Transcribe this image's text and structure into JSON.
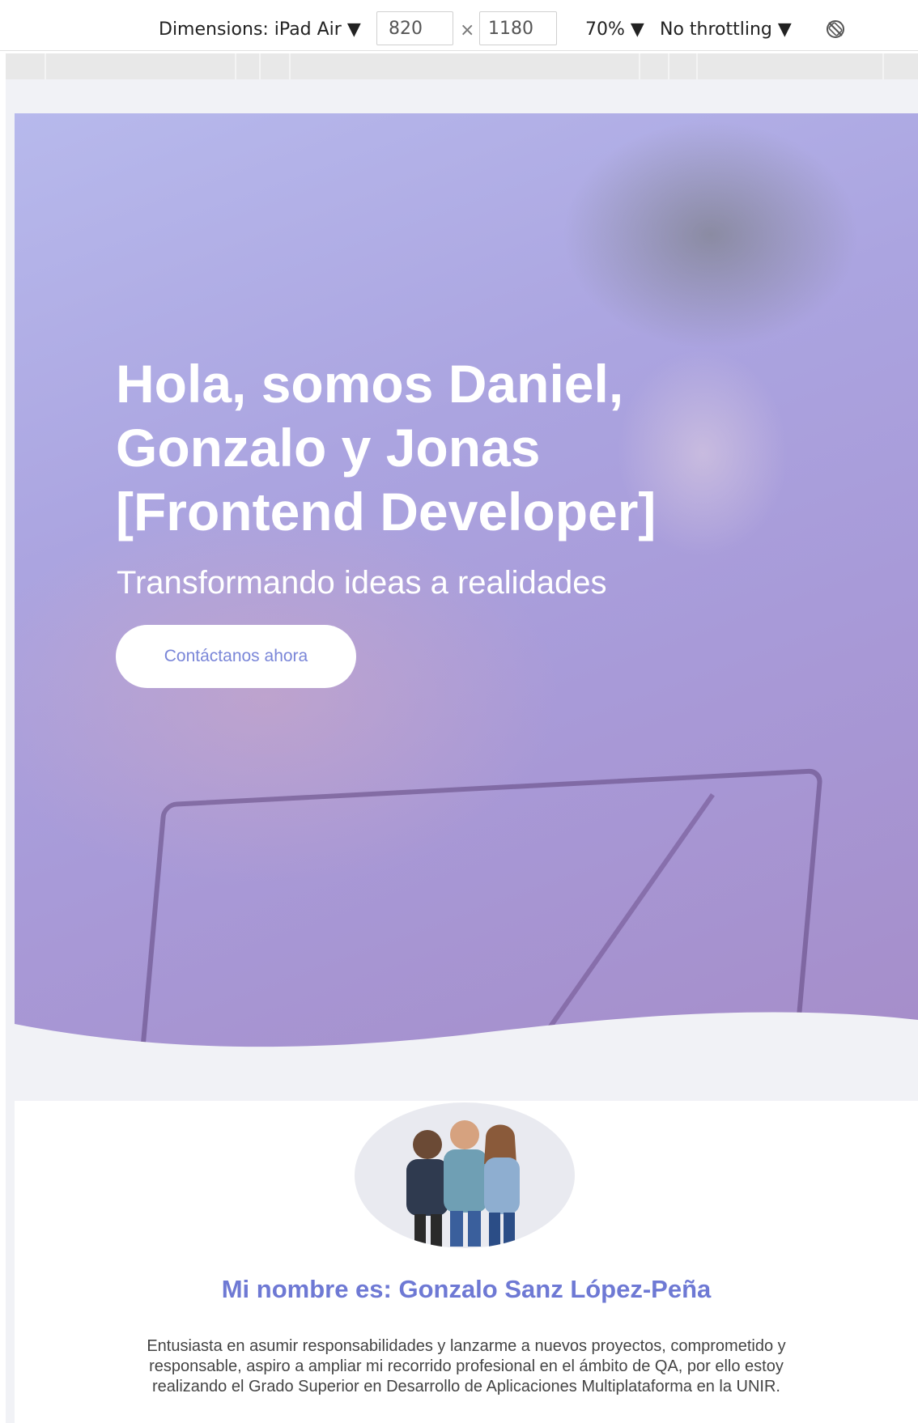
{
  "devtools": {
    "dimensions_label": "Dimensions: iPad Air ▼",
    "width_value": "820",
    "times": "×",
    "height_value": "1180",
    "zoom": "70% ▼",
    "throttling": "No throttling ▼",
    "rotate_icon": "rotate-icon"
  },
  "hero": {
    "title_line1": "Hola, somos Daniel,",
    "title_line2": "Gonzalo y Jonas",
    "title_line3": "[Frontend Developer]",
    "subtitle": "Transformando ideas a realidades",
    "cta": "Contáctanos ahora"
  },
  "about": {
    "name": "Mi nombre es: Gonzalo Sanz López-Peña",
    "text": "Entusiasta en asumir responsabilidades y lanzarme a nuevos proyectos, comprometido y responsable, aspiro a ampliar mi recorrido profesional en el ámbito de QA, por ello estoy realizando el Grado Superior en Desarrollo de Aplicaciones Multiplataforma en la UNIR."
  },
  "colors": {
    "accent": "#6e79d4",
    "hero_overlay": "#a89ad8",
    "viewport_bg": "#f1f2f6"
  }
}
